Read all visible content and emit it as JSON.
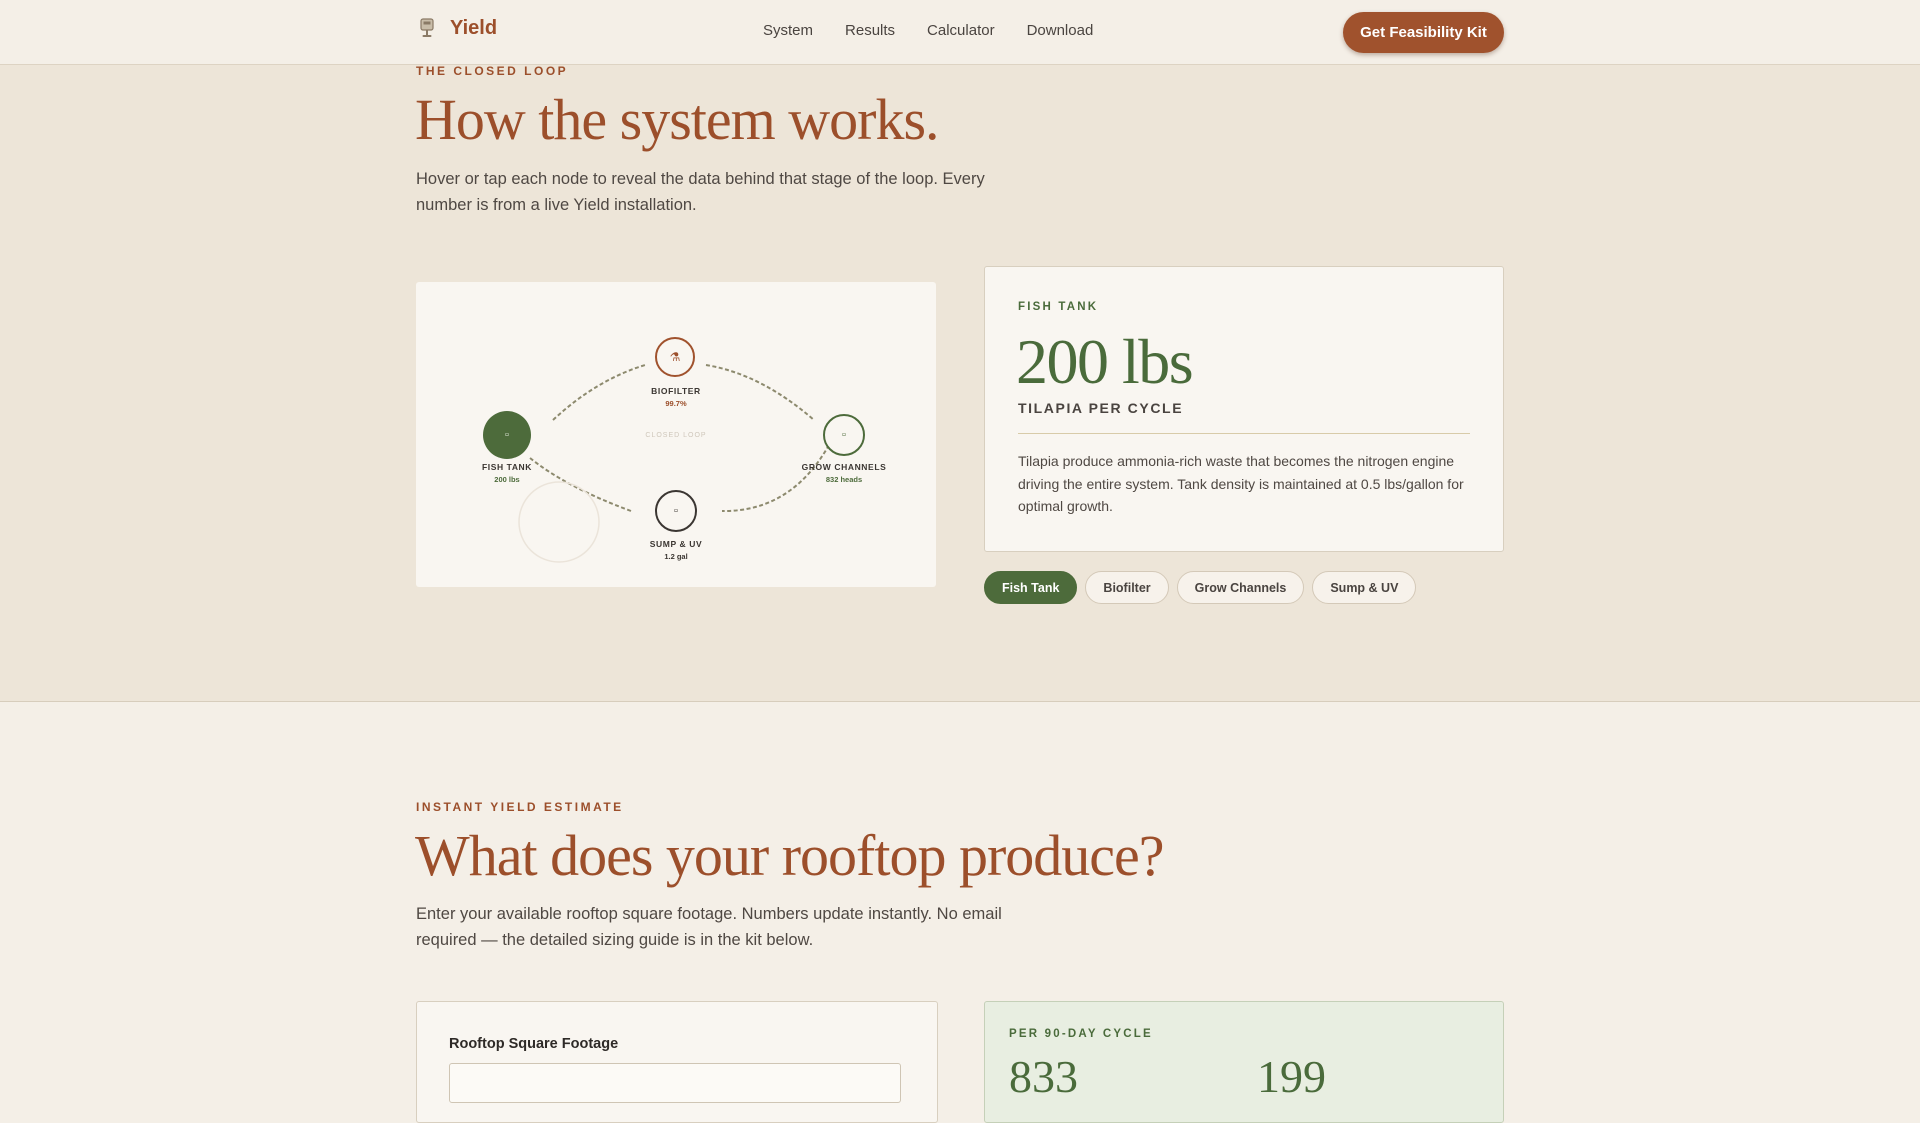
{
  "nav": {
    "brand": "Yield",
    "links": [
      "System",
      "Results",
      "Calculator",
      "Download"
    ],
    "cta": "Get Feasibility Kit"
  },
  "system": {
    "eyebrow": "THE CLOSED LOOP",
    "title": "How the system works.",
    "lede_line1": "Hover or tap each node to reveal the data behind that stage of the loop. Every",
    "lede_line2": "number is from a live Yield installation.",
    "diagram": {
      "center_label": "CLOSED LOOP",
      "nodes": [
        {
          "name": "FISH TANK",
          "value": "200 lbs",
          "icon": "fish-icon",
          "active": true
        },
        {
          "name": "BIOFILTER",
          "value": "99.7%",
          "icon": "flask-icon",
          "active": false
        },
        {
          "name": "GROW CHANNELS",
          "value": "832 heads",
          "icon": "leaf-icon",
          "active": false
        },
        {
          "name": "SUMP & UV",
          "value": "1.2 gal",
          "icon": "droplet-icon",
          "active": false
        }
      ]
    },
    "detail": {
      "eyebrow": "FISH TANK",
      "value": "200 lbs",
      "unit": "TILAPIA PER CYCLE",
      "description": "Tilapia produce ammonia-rich waste that becomes the nitrogen engine driving the entire system. Tank density is maintained at 0.5 lbs/gallon for optimal growth."
    },
    "tabs": [
      "Fish Tank",
      "Biofilter",
      "Grow Channels",
      "Sump & UV"
    ],
    "active_tab": "Fish Tank"
  },
  "estimate": {
    "eyebrow": "INSTANT YIELD ESTIMATE",
    "title": "What does your rooftop produce?",
    "lede_line1": "Enter your available rooftop square footage. Numbers update instantly. No email",
    "lede_line2": "required — the detailed sizing guide is in the kit below.",
    "input_label": "Rooftop Square Footage",
    "input_value": "",
    "result_eyebrow": "PER 90-DAY CYCLE",
    "result_primary": "833",
    "result_secondary": "199"
  },
  "colors": {
    "accent": "#9c4f2b",
    "green": "#4d6b3b",
    "section_bg": "#ede5d8",
    "page_bg": "#f4efe7"
  }
}
